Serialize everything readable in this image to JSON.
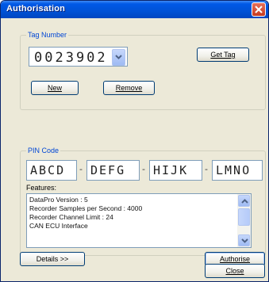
{
  "window": {
    "title": "Authorisation"
  },
  "tag_group": {
    "label": "Tag Number",
    "value": "0023902",
    "get_tag_label": "Get Tag",
    "new_label": "New",
    "remove_label": "Remove"
  },
  "pin_group": {
    "label": "PIN Code",
    "parts": [
      "ABCD",
      "DEFG",
      "HIJK",
      "LMNO"
    ],
    "separator": "-",
    "features_label": "Features:",
    "features": [
      "DataPro Version : 5",
      "Recorder Samples per Second : 4000",
      "Recorder Channel Limit : 24",
      "CAN ECU Interface"
    ]
  },
  "buttons": {
    "details_label": "Details >>",
    "authorise_label": "Authorise",
    "close_label": "Close"
  },
  "colors": {
    "title_bar": "#0052d6",
    "window_bg": "#ece9d8",
    "group_label": "#0046d5",
    "close_button": "#c63a1f"
  }
}
